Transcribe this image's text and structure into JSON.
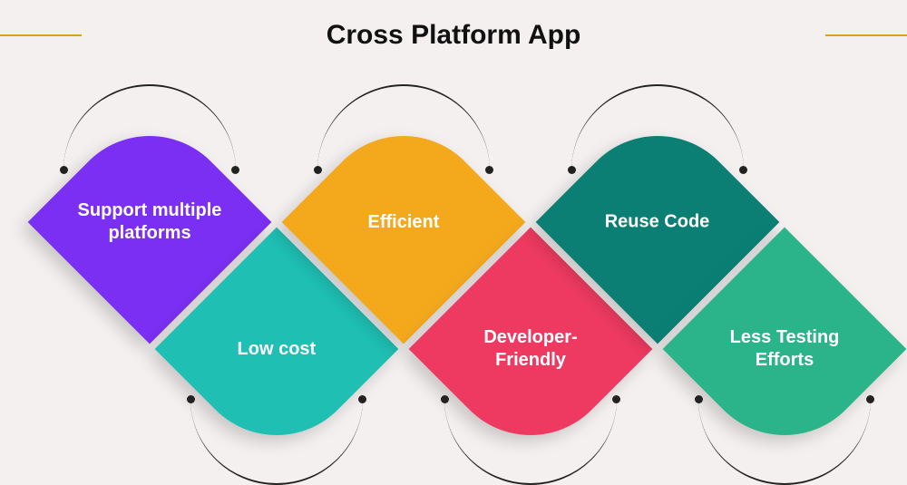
{
  "title": "Cross Platform App",
  "accent_color": "#d6a319",
  "tiles": [
    {
      "label": "Support multiple platforms",
      "color": "#7b2ff2",
      "position": "top"
    },
    {
      "label": "Low cost",
      "color": "#1fbfb4",
      "position": "bottom"
    },
    {
      "label": "Efficient",
      "color": "#f4a91d",
      "position": "top"
    },
    {
      "label": "Developer-Friendly",
      "color": "#ee3a60",
      "position": "bottom"
    },
    {
      "label": "Reuse Code",
      "color": "#0c7f75",
      "position": "top"
    },
    {
      "label": "Less Testing Efforts",
      "color": "#2bb38a",
      "position": "bottom"
    }
  ]
}
